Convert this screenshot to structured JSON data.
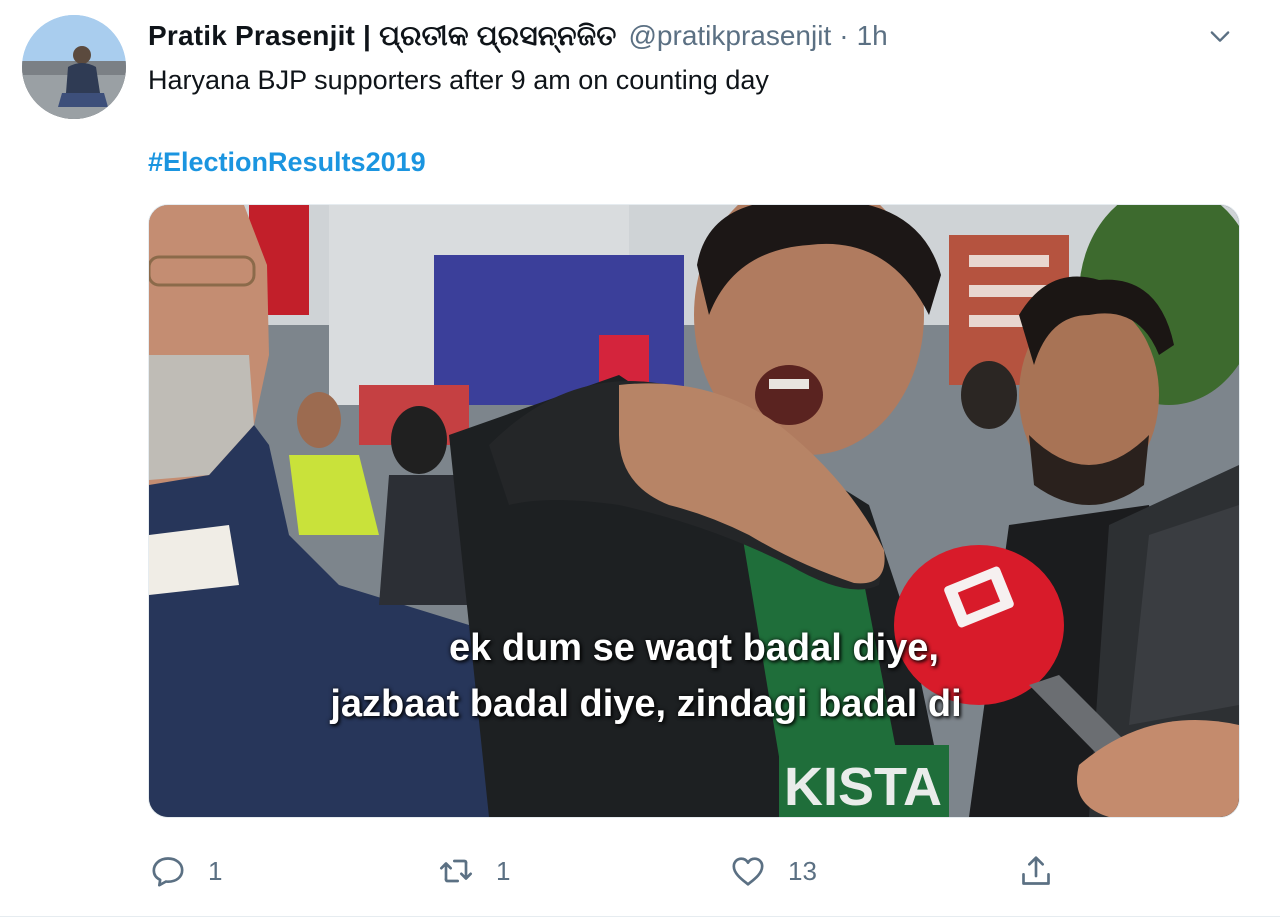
{
  "tweet": {
    "display_name": "Pratik Prasenjit | ପ୍ରତୀକ ପ୍ରସନ୍ନଜିତ",
    "handle": "@pratikprasenjit",
    "separator": "·",
    "time": "1h",
    "text": "Haryana BJP supporters after 9 am on counting day",
    "hashtag": "#ElectionResults2019",
    "avatar_icon": "user-avatar",
    "menu_icon": "chevron-down-icon"
  },
  "media": {
    "subtitle_line1": "ek dum se waqt badal diye,",
    "subtitle_line2": "jazbaat badal diye, zindagi badal di",
    "shirt_text": "KISTA"
  },
  "actions": {
    "reply": {
      "icon": "reply-icon",
      "count": "1"
    },
    "retweet": {
      "icon": "retweet-icon",
      "count": "1"
    },
    "like": {
      "icon": "heart-icon",
      "count": "13"
    },
    "share": {
      "icon": "share-icon"
    }
  },
  "colors": {
    "accent": "#1b95e0",
    "secondary_text": "#5b7083",
    "primary_text": "#0f1419"
  }
}
